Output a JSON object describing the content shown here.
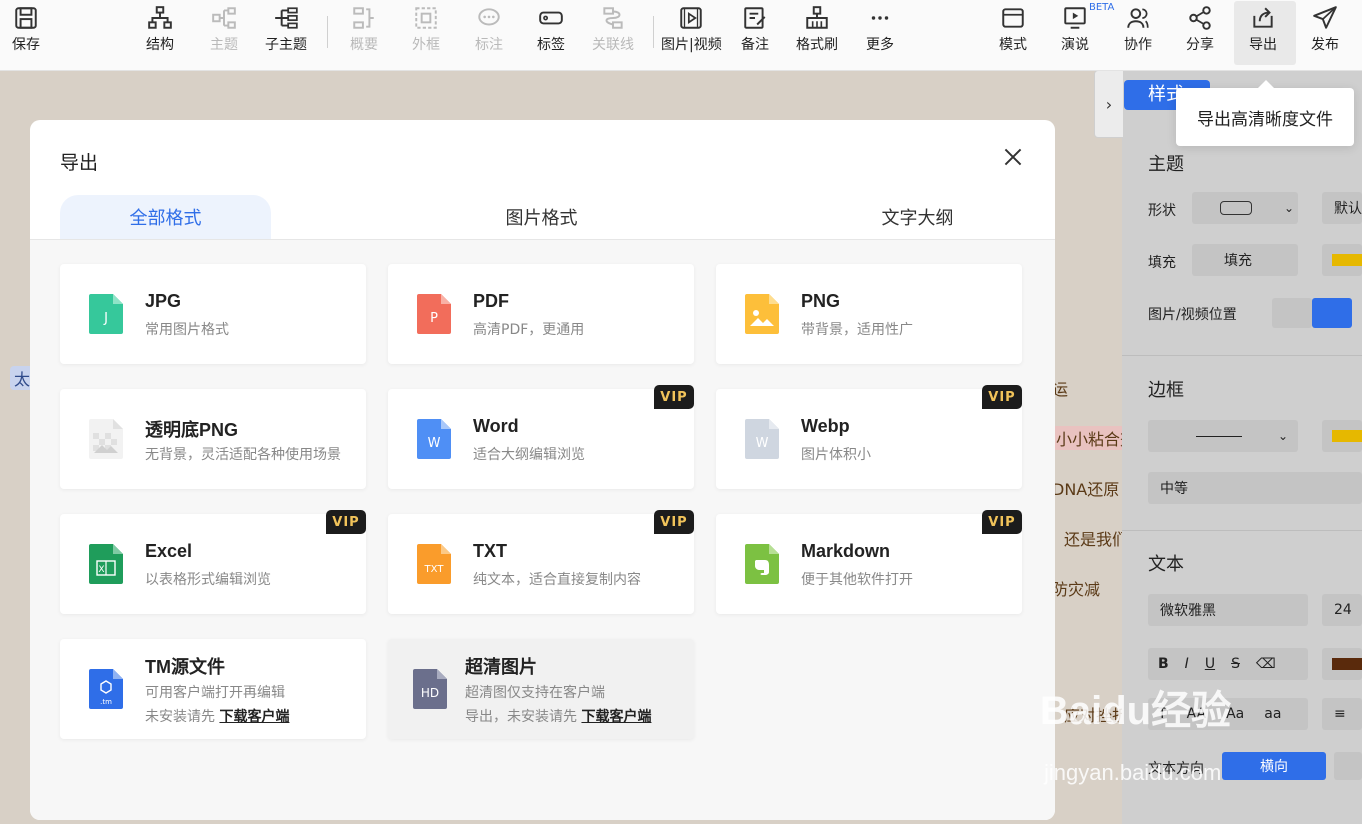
{
  "toolbar": {
    "save": "保存",
    "structure": "结构",
    "topic": "主题",
    "subtopic": "子主题",
    "summary": "概要",
    "frame": "外框",
    "note_mark": "标注",
    "tag": "标签",
    "relation": "关联线",
    "image_video": "图片|视频",
    "remark": "备注",
    "format_brush": "格式刷",
    "more": "更多",
    "mode": "模式",
    "present": "演说",
    "collab": "协作",
    "share": "分享",
    "export": "导出",
    "publish": "发布",
    "beta": "BETA"
  },
  "tooltip": "导出高清晰度文件",
  "right_panel": {
    "style_tab": "样式",
    "theme": "主题",
    "shape": "形状",
    "shape_default": "默认",
    "fill": "填充",
    "fill_value": "填充",
    "img_pos": "图片/视频位置",
    "border": "边框",
    "border_weight": "中等",
    "text": "文本",
    "font": "微软雅黑",
    "font_size": "24",
    "text_dir": "文本方向",
    "horizontal": "横向",
    "case_T": "T",
    "case_AA": "AA",
    "case_Aa": "Aa",
    "case_aa": "aa",
    "accent_color": "#2f6ee8",
    "swatch_yellow": "#e6b800",
    "swatch_brown": "#5a2a0c"
  },
  "canvas": {
    "left_node": "太",
    "nodes": [
      "运",
      "小小粘合剂",
      "DNA还原",
      "还是我们",
      "防灾减",
      "应对挫折"
    ]
  },
  "dialog": {
    "title": "导出",
    "tabs": [
      "全部格式",
      "图片格式",
      "文字大纲"
    ],
    "vip_label": "VIP",
    "cards": [
      {
        "name": "JPG",
        "desc": "常用图片格式",
        "icon": "J",
        "color": "#36c89b",
        "vip": false
      },
      {
        "name": "PDF",
        "desc": "高清PDF，更通用",
        "icon": "P",
        "color": "#f26d5b",
        "vip": false
      },
      {
        "name": "PNG",
        "desc": "带背景，适用性广",
        "icon": "img",
        "color": "#fdbf3a",
        "vip": false
      },
      {
        "name": "透明底PNG",
        "desc": "无背景，灵活适配各种使用场景",
        "icon": "img",
        "color": "#e8e8e8",
        "vip": false
      },
      {
        "name": "Word",
        "desc": "适合大纲编辑浏览",
        "icon": "W",
        "color": "#4f8ff5",
        "vip": true
      },
      {
        "name": "Webp",
        "desc": "图片体积小",
        "icon": "W",
        "color": "#cfd6e0",
        "vip": true
      },
      {
        "name": "Excel",
        "desc": "以表格形式编辑浏览",
        "icon": "X",
        "color": "#1f9d5b",
        "vip": true
      },
      {
        "name": "TXT",
        "desc": "纯文本，适合直接复制内容",
        "icon": "TXT",
        "color": "#fa9c2b",
        "vip": true
      },
      {
        "name": "Markdown",
        "desc": "便于其他软件打开",
        "icon": "E",
        "color": "#7cc142",
        "vip": true
      }
    ],
    "tm": {
      "name": "TM源文件",
      "desc": "可用客户端打开再编辑",
      "desc2_prefix": "未安装请先",
      "link": "下载客户端",
      "icon": ".tm",
      "color": "#2f6ee8"
    },
    "hd": {
      "name": "超清图片",
      "desc": "超清图仅支持在客户端",
      "desc2_prefix": "导出，未安装请先",
      "link": "下载客户端",
      "icon": "HD",
      "color": "#6b6f8c"
    }
  },
  "watermark": {
    "logo": "Baidu经验",
    "url": "jingyan.baidu.com"
  }
}
